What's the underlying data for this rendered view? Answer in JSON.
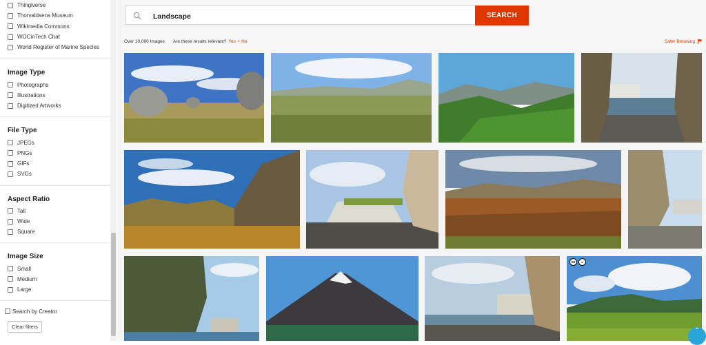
{
  "sidebar": {
    "sources": [
      "Thingiverse",
      "Thorvaldsens Museum",
      "Wikimedia Commons",
      "WOCinTech Chat",
      "World Register of Marine Species"
    ],
    "image_type": {
      "title": "Image Type",
      "options": [
        "Photographs",
        "Illustrations",
        "Digitized Artworks"
      ]
    },
    "file_type": {
      "title": "File Type",
      "options": [
        "JPEGs",
        "PNGs",
        "GIFs",
        "SVGs"
      ]
    },
    "aspect_ratio": {
      "title": "Aspect Ratio",
      "options": [
        "Tall",
        "Wide",
        "Square"
      ]
    },
    "image_size": {
      "title": "Image Size",
      "options": [
        "Small",
        "Medium",
        "Large"
      ]
    },
    "search_by_creator": "Search by Creator",
    "clear_filters": "Clear filters"
  },
  "search": {
    "value": "Landscape",
    "button_label": "SEARCH"
  },
  "results": {
    "count": "Over 10,000 Images",
    "relevance_question": "Are these results relevant?",
    "yes": "Yes",
    "sep": "•",
    "no": "No",
    "safer_browsing": "Safer Browsing"
  },
  "colors": {
    "accent": "#e23600",
    "scroll_button": "#2aa5d7"
  },
  "icons": {
    "search": "search-icon",
    "flag": "flag-icon",
    "scroll_top": "arrow-up-icon",
    "license": "cc-icon"
  }
}
